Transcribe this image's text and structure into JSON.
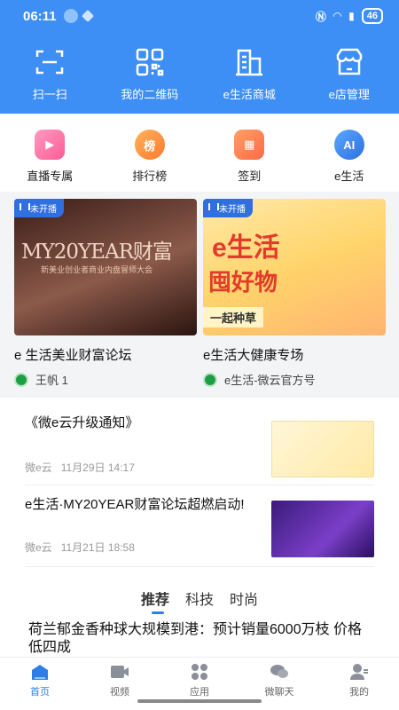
{
  "status_bar": {
    "time": "06:11",
    "battery": "46"
  },
  "top_nav": [
    {
      "label": "扫一扫",
      "icon": "scan-icon"
    },
    {
      "label": "我的二维码",
      "icon": "qrcode-icon"
    },
    {
      "label": "e生活商城",
      "icon": "store-icon"
    },
    {
      "label": "e店管理",
      "icon": "shop-manage-icon"
    }
  ],
  "categories": [
    {
      "label": "直播专属",
      "icon": "live-camera-icon",
      "color": "#ff6fa0"
    },
    {
      "label": "排行榜",
      "icon": "ranking-icon",
      "color": "#ff8a3d",
      "glyph": "榜"
    },
    {
      "label": "签到",
      "icon": "calendar-icon",
      "color": "#ff7a4a"
    },
    {
      "label": "e生活",
      "icon": "ai-icon",
      "color": "#2f7ee8",
      "glyph": "AI"
    }
  ],
  "live_cards": [
    {
      "badge": "未开播",
      "title": "e 生活美业财富论坛",
      "author": "王帆 1",
      "img_text": "MY20YEAR财富",
      "img_sub": "新美业创业者商业内盘冒师大会"
    },
    {
      "badge": "未开播",
      "title": "e生活大健康专场",
      "author": "e生活-微云官方号",
      "img_text": "e生活",
      "img_sub": "囤好物",
      "img_sub2": "一起种草"
    }
  ],
  "news": [
    {
      "title": "《微e云升级通知》",
      "source": "微e云",
      "date": "11月29日 14:17"
    },
    {
      "title": "e生活·MY20YEAR财富论坛超燃启动!",
      "source": "微e云",
      "date": "11月21日 18:58"
    }
  ],
  "tabs": [
    {
      "label": "推荐"
    },
    {
      "label": "科技"
    },
    {
      "label": "时尚"
    }
  ],
  "feed_headline": "荷兰郁金香种球大规模到港：预计销量6000万枝 价格低四成",
  "bottom_nav": [
    {
      "label": "首页",
      "icon": "home-icon"
    },
    {
      "label": "视频",
      "icon": "video-icon"
    },
    {
      "label": "应用",
      "icon": "apps-icon"
    },
    {
      "label": "微聊天",
      "icon": "chat-icon"
    },
    {
      "label": "我的",
      "icon": "profile-icon"
    }
  ],
  "colors": {
    "primary": "#3d8ef5",
    "accent": "#2f7ee8"
  }
}
